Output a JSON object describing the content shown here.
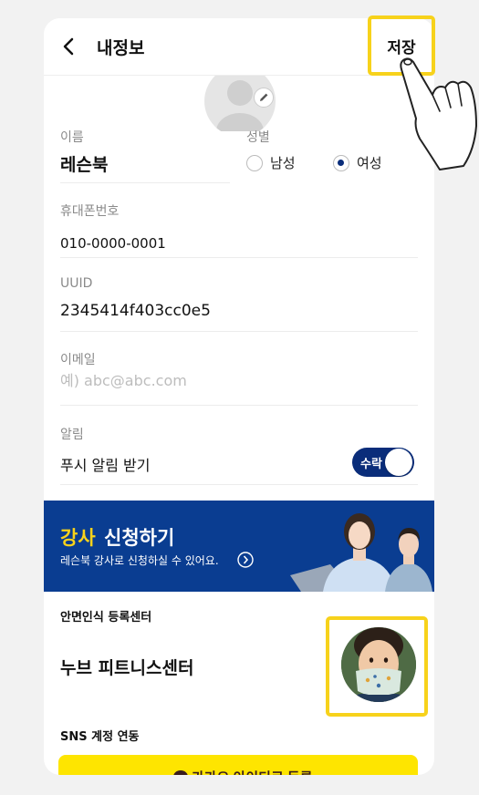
{
  "header": {
    "title": "내정보",
    "save_label": "저장"
  },
  "profile": {
    "name_label": "이름",
    "name_value": "레슨북",
    "gender_label": "성별",
    "gender_options": [
      "남성",
      "여성"
    ],
    "gender_selected": "여성"
  },
  "phone": {
    "label": "휴대폰번호",
    "value": "010-0000-0001"
  },
  "uuid": {
    "label": "UUID",
    "value": "2345414f403cc0e5"
  },
  "email": {
    "label": "이메일",
    "placeholder": "예) abc@abc.com"
  },
  "notification": {
    "label": "알림",
    "push_label": "푸시 알림 받기",
    "toggle_label": "수락",
    "enabled": true
  },
  "banner": {
    "title_highlight": "강사",
    "title_rest": "신청하기",
    "subtitle": "레슨북 강사로 신청하실 수 있어요."
  },
  "face_registration": {
    "section_label": "안면인식 등록센터",
    "center_name": "누브 피트니스센터"
  },
  "sns": {
    "section_label": "SNS 계정 연동",
    "kakao_button_label": "카카오 아이디로 등록"
  },
  "colors": {
    "accent": "#f7d21b",
    "navy": "#0a2d7a",
    "banner_bg": "#0a3d91",
    "kakao": "#fee500"
  }
}
